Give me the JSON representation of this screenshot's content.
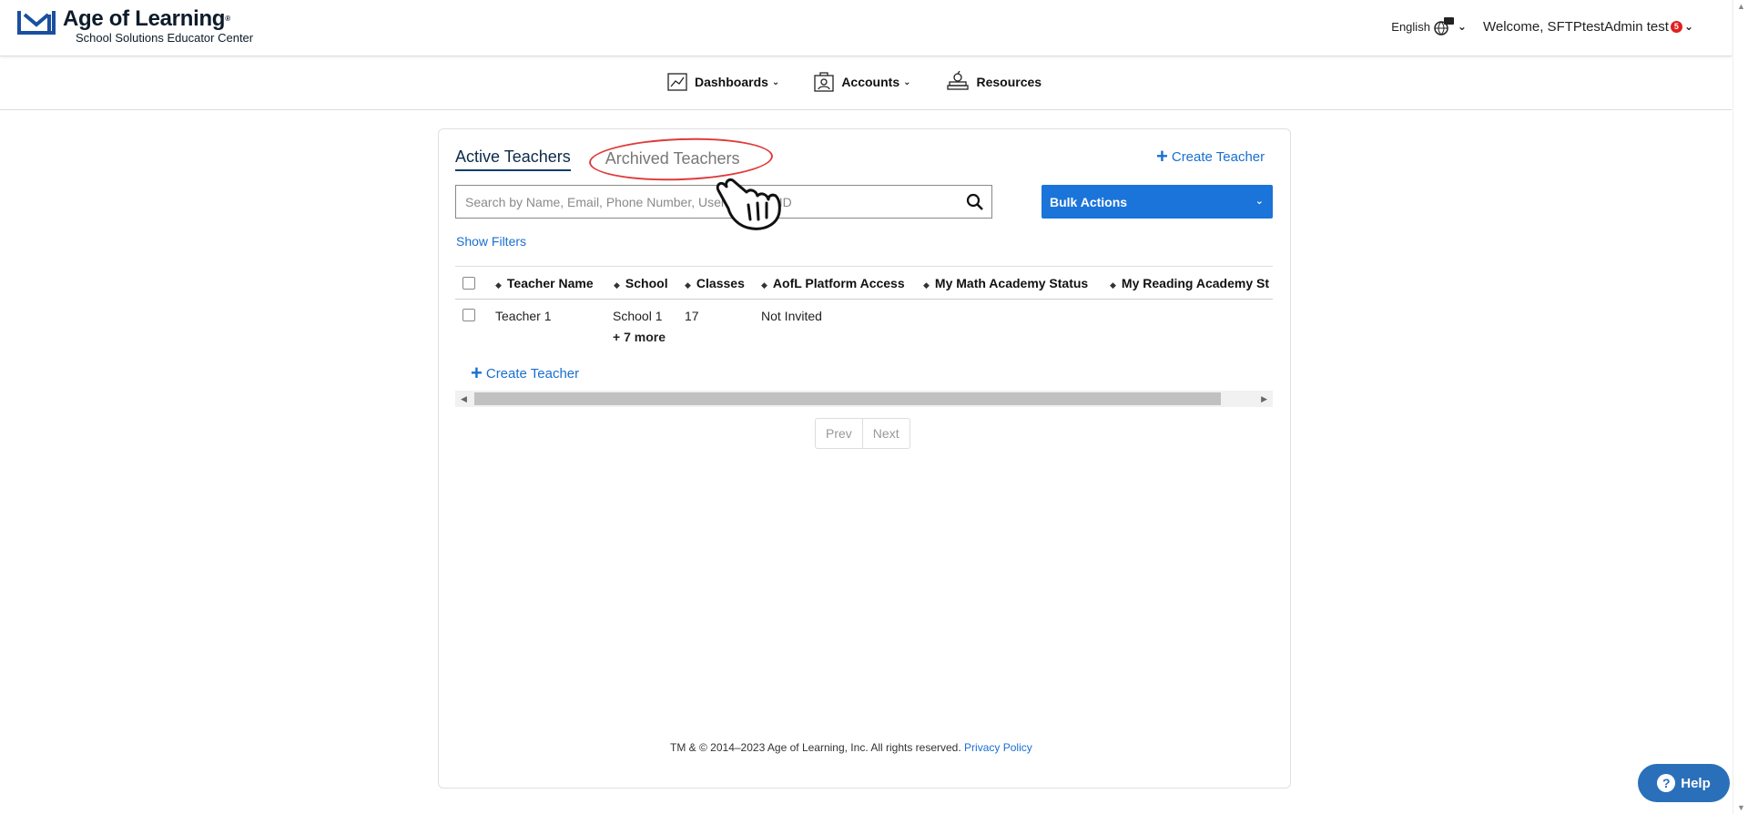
{
  "header": {
    "brand": "Age of Learning",
    "brand_mark": "®",
    "subtitle": "School Solutions Educator Center",
    "language": "English",
    "welcome": "Welcome, SFTPtestAdmin test",
    "notification_count": "5"
  },
  "nav": {
    "items": [
      {
        "label": "Dashboards",
        "icon": "chart-icon",
        "has_caret": true
      },
      {
        "label": "Accounts",
        "icon": "accounts-icon",
        "has_caret": true
      },
      {
        "label": "Resources",
        "icon": "books-icon",
        "has_caret": false
      }
    ]
  },
  "tabs": {
    "active": "Active Teachers",
    "archived": "Archived Teachers"
  },
  "actions": {
    "create_teacher": "Create Teacher",
    "bulk_actions": "Bulk Actions",
    "show_filters": "Show Filters"
  },
  "search": {
    "placeholder": "Search by Name, Email, Phone Number, Username, or ID"
  },
  "table": {
    "columns": [
      "Teacher Name",
      "School",
      "Classes",
      "AofL Platform Access",
      "My Math Academy Status",
      "My Reading Academy St"
    ],
    "rows": [
      {
        "teacher_name": "Teacher 1",
        "school": "School 1",
        "school_more": "+ 7 more",
        "classes": "17",
        "platform_access": "Not Invited"
      }
    ]
  },
  "pager": {
    "prev": "Prev",
    "next": "Next"
  },
  "footer": {
    "copyright": "TM & © 2014–2023 Age of Learning, Inc. All rights reserved.",
    "privacy": "Privacy Policy"
  },
  "help": {
    "label": "Help"
  },
  "colors": {
    "accent": "#1a74d9",
    "link": "#1a6fd1",
    "highlight": "#e03a3a",
    "help": "#2a6fba"
  }
}
